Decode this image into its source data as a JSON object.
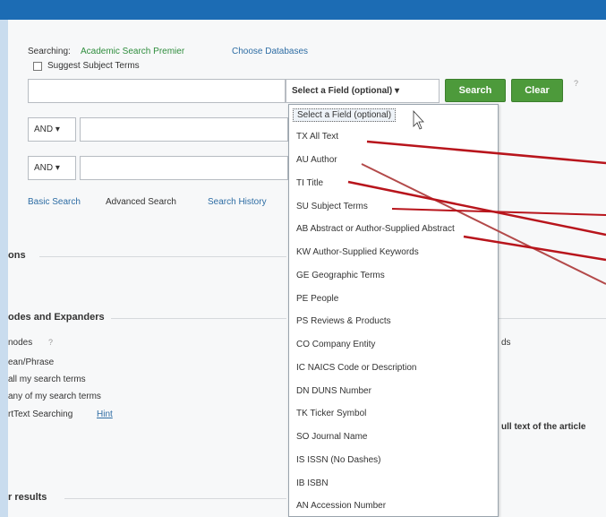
{
  "search": {
    "searching_label": "Searching:",
    "database_name": "Academic Search Premier",
    "choose_databases": "Choose Databases",
    "suggest_subject_terms": "Suggest Subject Terms",
    "select_field_label": "Select a Field (optional) ▾",
    "search_button": "Search",
    "clear_button": "Clear",
    "help_mark": "?",
    "and_operator_1": "AND ▾",
    "and_operator_2": "AND ▾"
  },
  "nav_links": {
    "basic_search": "Basic Search",
    "advanced_search": "Advanced Search",
    "search_history": "Search History"
  },
  "sections": {
    "options": "ons",
    "modes_and_expanders": "odes and Expanders",
    "modes_label": "nodes",
    "modes_help": "?",
    "mode_items": [
      "ean/Phrase",
      "all my search terms",
      "any of my search terms",
      "rtText Searching"
    ],
    "hint": "Hint",
    "right_text_1": "ds",
    "right_text_2": "ull text of the article",
    "results": "r results"
  },
  "field_dropdown": {
    "items": [
      "Select a Field (optional)",
      "TX All Text",
      "AU Author",
      "TI Title",
      "SU Subject Terms",
      "AB Abstract or Author-Supplied Abstract",
      "KW Author-Supplied Keywords",
      "GE Geographic Terms",
      "PE People",
      "PS Reviews & Products",
      "CO Company Entity",
      "IC NAICS Code or Description",
      "DN DUNS Number",
      "TK Ticker Symbol",
      "SO Journal Name",
      "IS ISSN (No Dashes)",
      "IB ISBN",
      "AN Accession Number"
    ]
  },
  "colors": {
    "topbar": "#1c6cb4",
    "button_green": "#4d9a3b",
    "link_blue": "#2e6da4",
    "annotation_red": "#b8151c"
  }
}
